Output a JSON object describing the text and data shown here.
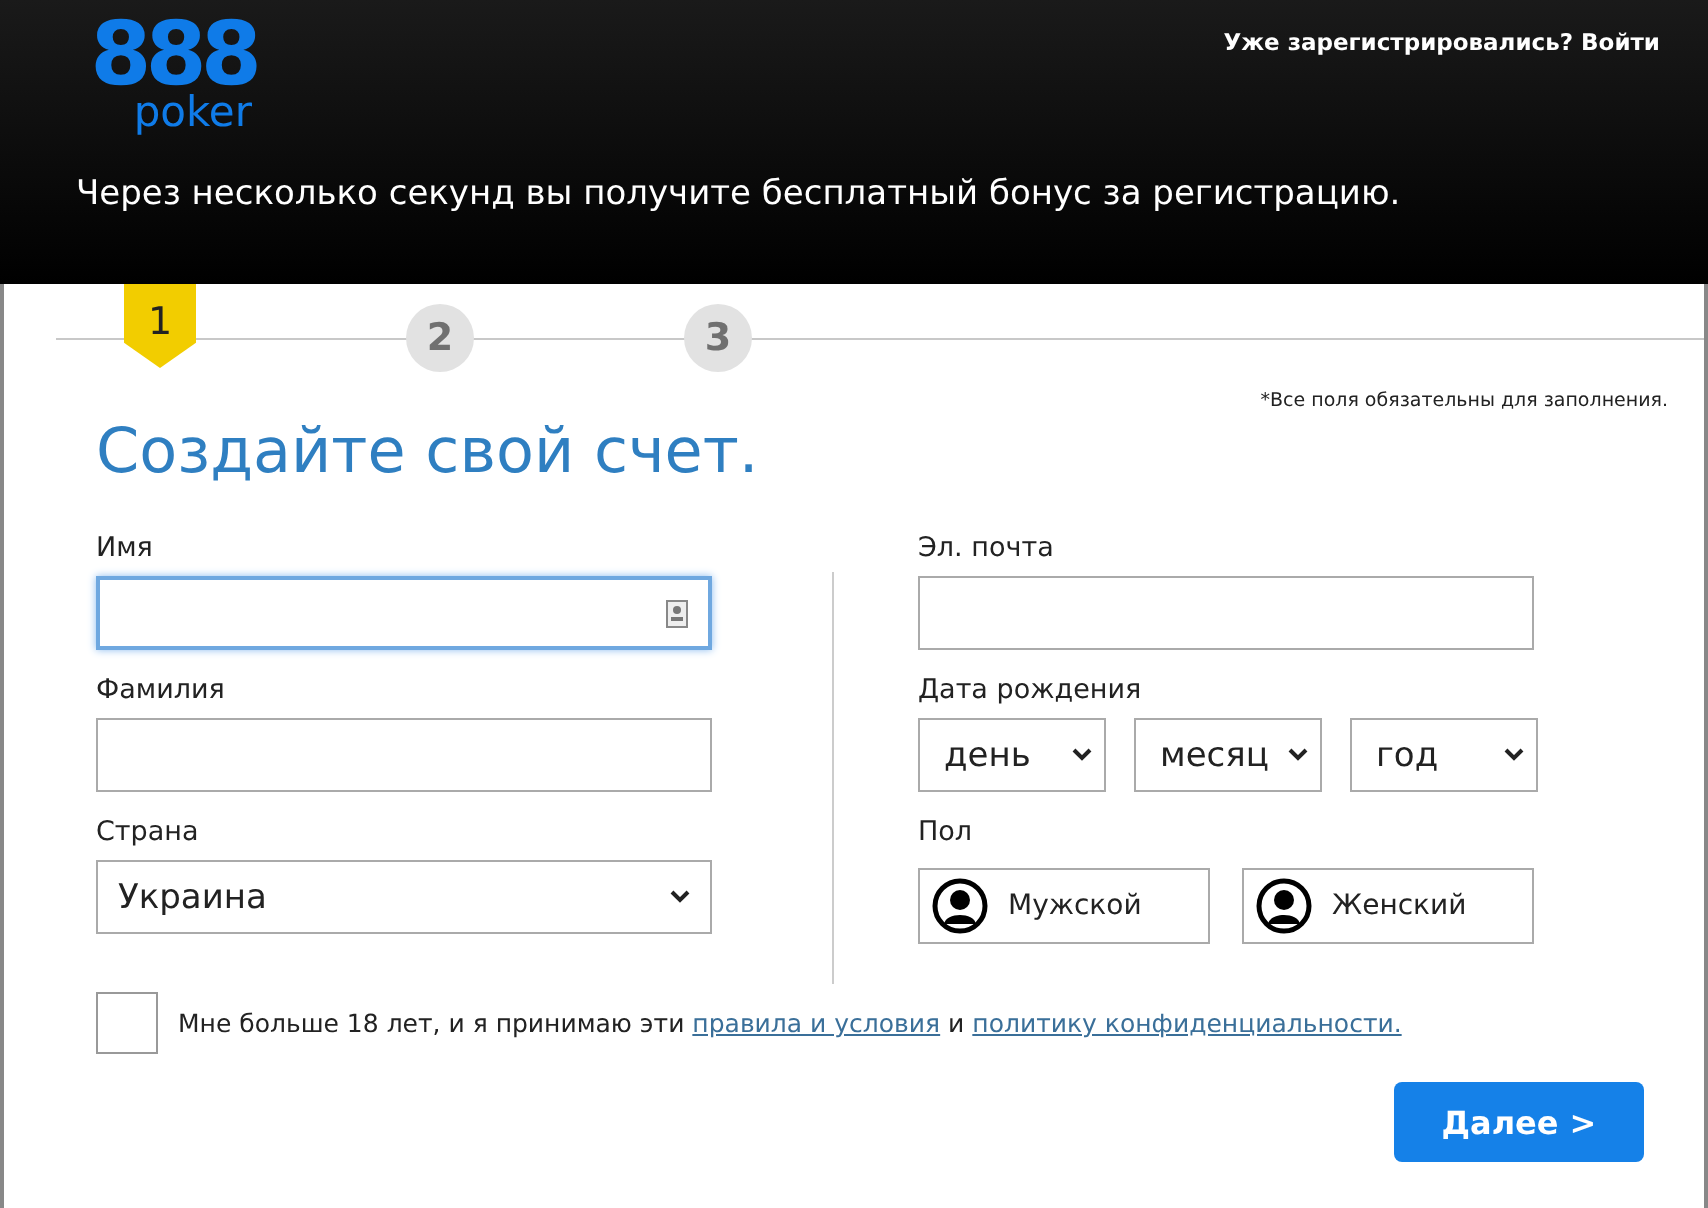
{
  "header": {
    "logo": {
      "digits": "888",
      "word": "poker"
    },
    "login_link": "Уже зарегистрировались? Войти",
    "tagline": "Через несколько секунд вы получите бесплатный бонус за регистрацию."
  },
  "steps": [
    {
      "label": "1",
      "selected": true
    },
    {
      "label": "2",
      "selected": false
    },
    {
      "label": "3",
      "selected": false
    }
  ],
  "required_note": "*Все поля обязательны для заполнения.",
  "title": "Создайте свой счет.",
  "left_fields": [
    {
      "kind": "text",
      "label": "Имя",
      "focused": true
    },
    {
      "kind": "text",
      "label": "Фамилия",
      "focused": false
    },
    {
      "kind": "select",
      "label": "Страна",
      "value": "Украина",
      "focused": false
    }
  ],
  "email": {
    "label": "Эл. почта"
  },
  "birth_date": {
    "label": "Дата рождения",
    "selects": [
      "день",
      "месяц",
      "год"
    ]
  },
  "gender": {
    "label": "Пол",
    "options": [
      {
        "label": "Мужской",
        "selected": false
      },
      {
        "label": "Женский",
        "selected": false
      }
    ]
  },
  "agreement": {
    "checked": false,
    "text": "Мне больше 18 лет, и я принимаю эти ",
    "link_terms": "правила и условия",
    "joiner": " и ",
    "link_privacy": "политику конфиденциальности."
  },
  "next_button": "Далее >"
}
